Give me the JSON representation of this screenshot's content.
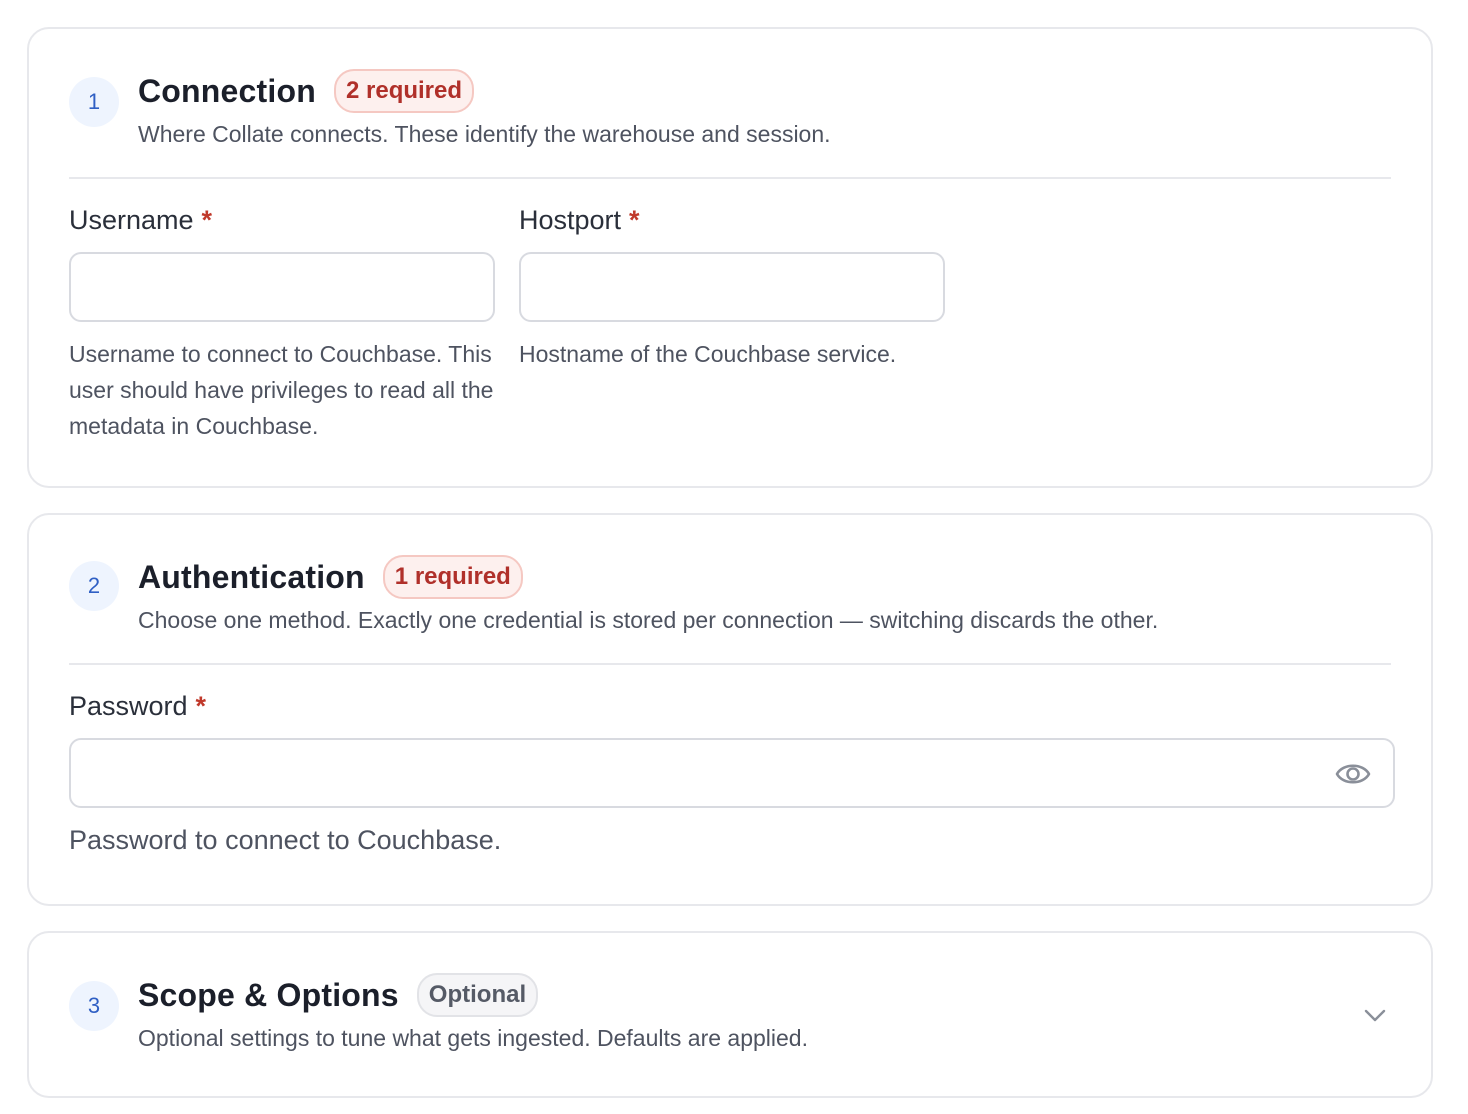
{
  "sections": [
    {
      "step": "1",
      "title": "Connection",
      "badge": "2 required",
      "description": "Where Collate connects. These identify the warehouse and session.",
      "fields": [
        {
          "label": "Username",
          "required_marker": "*",
          "value": "",
          "help": "Username to connect to Couchbase. This user should have privileges to read all the metadata in Couchbase."
        },
        {
          "label": "Hostport",
          "required_marker": "*",
          "value": "",
          "help": "Hostname of the Couchbase service."
        }
      ]
    },
    {
      "step": "2",
      "title": "Authentication",
      "badge": "1 required",
      "description": "Choose one method. Exactly one credential is stored per connection — switching discards the other.",
      "fields": [
        {
          "label": "Password",
          "required_marker": "*",
          "value": "",
          "help": "Password to connect to Couchbase.",
          "icon": "eye-icon"
        }
      ]
    },
    {
      "step": "3",
      "title": "Scope & Options",
      "badge": "Optional",
      "description": "Optional settings to tune what gets ingested. Defaults are applied.",
      "collapsed": true,
      "icon": "chevron-down-icon"
    }
  ],
  "colors": {
    "required_accent": "#c0392b",
    "step_accent": "#2f5fc4"
  }
}
